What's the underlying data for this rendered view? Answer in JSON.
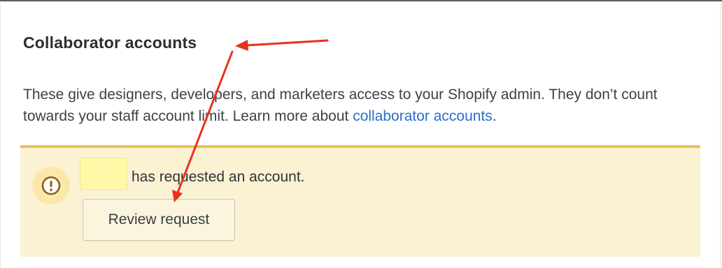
{
  "section": {
    "title": "Collaborator accounts",
    "description_text": "These give designers, developers, and marketers access to your Shopify admin. They don’t count towards your staff account limit. Learn more about ",
    "description_link": "collaborator accounts",
    "description_end": "."
  },
  "banner": {
    "icon": "warning-icon",
    "message": "has requested an account.",
    "review_button_label": "Review request"
  },
  "colors": {
    "link": "#2c6ecb",
    "banner_bg": "#fbf2d3",
    "banner_border": "#e8c256",
    "annotation_arrow": "#e8321e"
  }
}
